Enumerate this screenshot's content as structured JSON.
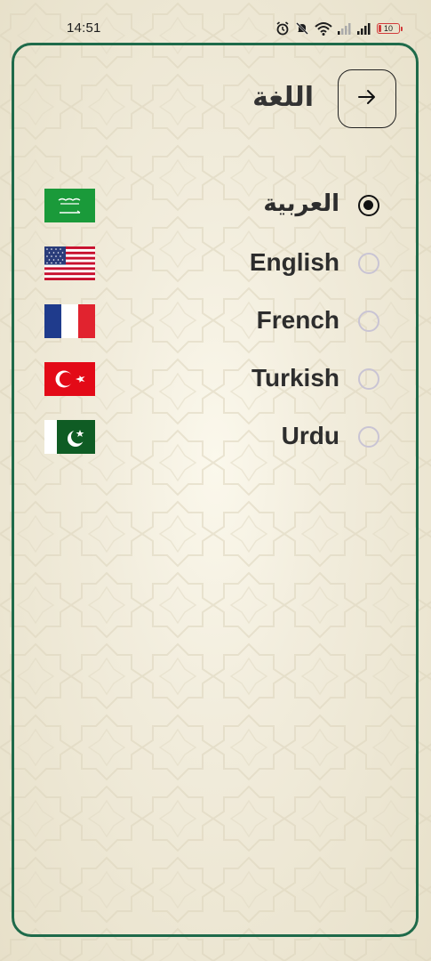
{
  "status_bar": {
    "time": "14:51",
    "battery_level": "10",
    "icons": [
      "alarm-icon",
      "mute-icon",
      "wifi-icon",
      "signal-icon",
      "signal-icon",
      "battery-icon"
    ]
  },
  "header": {
    "title": "اللغة",
    "back_icon": "arrow-right-icon"
  },
  "languages": [
    {
      "label": "العربية",
      "flag": "saudi-arabia-flag",
      "selected": true
    },
    {
      "label": "English",
      "flag": "usa-flag",
      "selected": false
    },
    {
      "label": "French",
      "flag": "france-flag",
      "selected": false
    },
    {
      "label": "Turkish",
      "flag": "turkey-flag",
      "selected": false
    },
    {
      "label": "Urdu",
      "flag": "pakistan-flag",
      "selected": false
    }
  ],
  "colors": {
    "frame_border": "#1e6a4a",
    "background": "#f2eddd",
    "text": "#2d2d2d",
    "radio_unselected": "#c9c4d4"
  }
}
